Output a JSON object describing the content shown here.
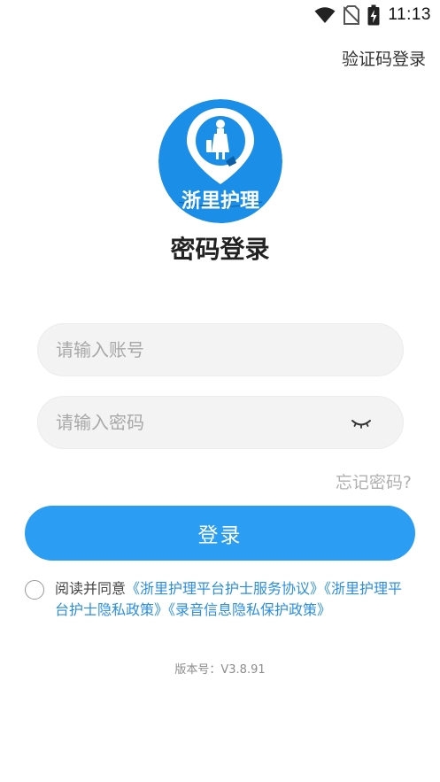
{
  "status_bar": {
    "time": "11:13",
    "icons": [
      "wifi-icon",
      "no-sim-icon",
      "battery-charging-icon"
    ]
  },
  "header": {
    "switch_link": "验证码登录"
  },
  "logo": {
    "text": "浙里护理"
  },
  "title": "密码登录",
  "form": {
    "account_placeholder": "请输入账号",
    "password_placeholder": "请输入密码",
    "forgot_link": "忘记密码?",
    "submit_label": "登录"
  },
  "agreement": {
    "prefix": "阅读并同意",
    "link_service": "《浙里护理平台护士服务协议》",
    "link_privacy": "《浙里护理平台护士隐私政策》",
    "link_recording": "《录音信息隐私保护政策》"
  },
  "version": "版本号：V3.8.91",
  "colors": {
    "primary": "#2b9df2",
    "link": "#2b8fe0",
    "field_bg": "#f3f3f3"
  }
}
